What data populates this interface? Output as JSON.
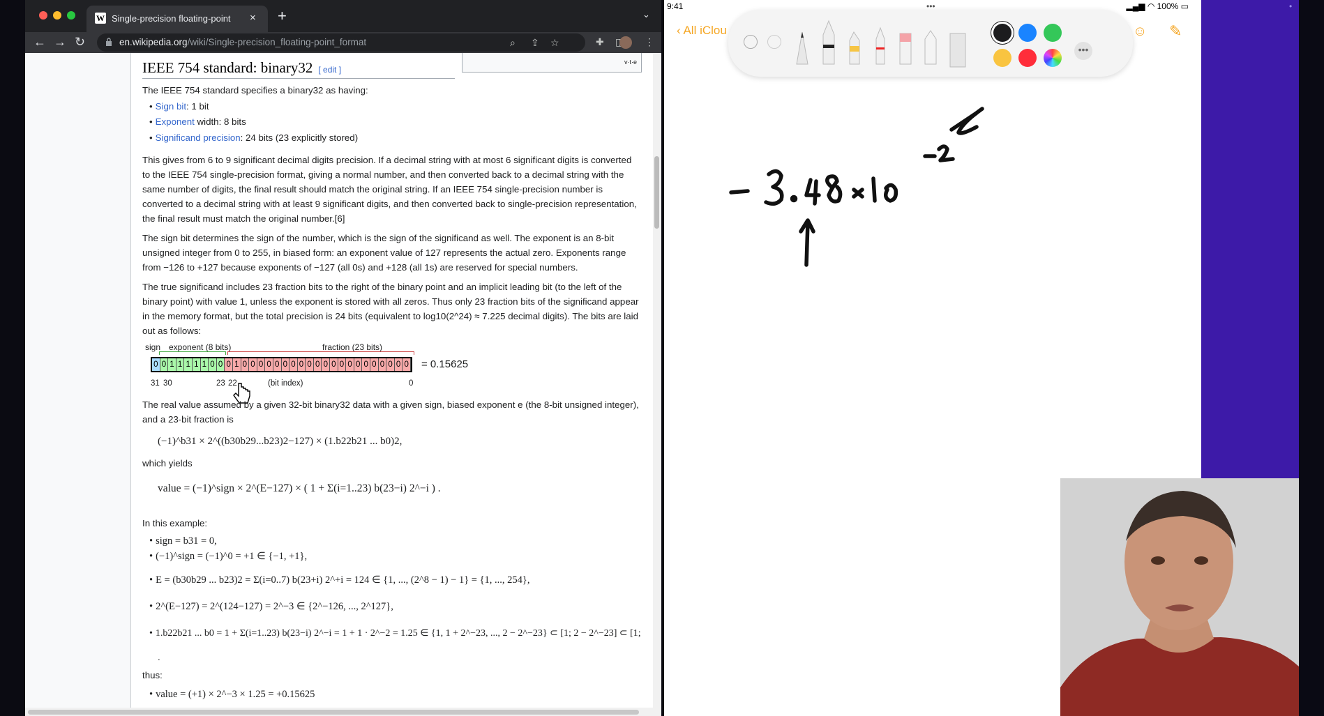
{
  "browser": {
    "tab_title": "Single-precision floating-point",
    "url_domain": "en.wikipedia.org",
    "url_path": "/wiki/Single-precision_floating-point_format",
    "favicon_letter": "W"
  },
  "article": {
    "navbox_label": "v·t·e",
    "heading": "IEEE 754 standard: binary32",
    "edit_label": "[ edit ]",
    "intro": "The IEEE 754 standard specifies a binary32 as having:",
    "bullets": [
      {
        "link": "Sign bit",
        "rest": ": 1 bit"
      },
      {
        "link": "Exponent",
        "rest": " width: 8 bits"
      },
      {
        "link": "Significand precision",
        "rest": ": 24 bits (23 explicitly stored)"
      }
    ],
    "para1_lines": [
      "This gives from 6 to 9 significant decimal digits precision. If a decimal string with at most 6 significant digits is converted",
      "to the IEEE 754 single-precision format, giving a normal number, and then converted back to a decimal string with the",
      "same number of digits, the final result should match the original string. If an IEEE 754 single-precision number is",
      "converted to a decimal string with at least 9 significant digits, and then converted back to single-precision representation,",
      "the final result must match the original number.[6]"
    ],
    "para2_lines": [
      "The sign bit determines the sign of the number, which is the sign of the significand as well. The exponent is an 8-bit",
      "unsigned integer from 0 to 255, in biased form: an exponent value of 127 represents the actual zero. Exponents range",
      "from −126 to +127 because exponents of −127 (all 0s) and +128 (all 1s) are reserved for special numbers."
    ],
    "para3_lines": [
      "The true significand includes 23 fraction bits to the right of the binary point and an implicit leading bit (to the left of the",
      "binary point) with value 1, unless the exponent is stored with all zeros. Thus only 23 fraction bits of the significand appear",
      "in the memory format, but the total precision is 24 bits (equivalent to log10(2^24) ≈ 7.225 decimal digits). The bits are laid",
      "out as follows:"
    ],
    "diagram": {
      "sign_label": "sign",
      "exponent_label": "exponent (8 bits)",
      "fraction_label": "fraction (23 bits)",
      "bits": "00111110001000000000000000000000",
      "result": "= 0.15625",
      "index_labels": [
        "31",
        "30",
        "23",
        "22",
        "(bit index)",
        "0"
      ]
    },
    "para4_lines": [
      "The real value assumed by a given 32-bit binary32 data with a given sign, biased exponent e (the 8-bit unsigned integer),",
      "and a 23-bit fraction is"
    ],
    "formula1": "(−1)^b31 × 2^((b30b29...b23)2−127) × (1.b22b21 ... b0)2,",
    "which_yields": "which yields",
    "formula2": "value = (−1)^sign × 2^(E−127) × ( 1 + Σ(i=1..23) b(23−i) 2^−i ) .",
    "example_label": "In this example:",
    "example_items": [
      "sign = b31 = 0,",
      "(−1)^sign = (−1)^0 = +1 ∈ {−1, +1},",
      "E = (b30b29 ... b23)2 = Σ(i=0..7) b(23+i) 2^+i = 124 ∈ {1, ..., (2^8 − 1) − 1} = {1, ..., 254},",
      "2^(E−127) = 2^(124−127) = 2^−3 ∈ {2^−126, ..., 2^127},",
      "1.b22b21 ... b0 = 1 + Σ(i=1..23) b(23−i) 2^−i = 1 + 1 · 2^−2 = 1.25 ∈ {1, 1 + 2^−23, ..., 2 − 2^−23} ⊂ [1; 2 − 2^−23] ⊂ [1;"
    ],
    "trailing_dot": ".",
    "thus_label": "thus:",
    "final_item": "value = (+1) × 2^−3 × 1.25 = +0.15625"
  },
  "ipad": {
    "time": "9:41",
    "battery": "100%",
    "back_label": "All iClou",
    "handwriting": "−3.48 × 10^−2",
    "colors": [
      "#1c1c1e",
      "#1a84ff",
      "#34c759",
      "#f9c440",
      "#ff2d3a"
    ]
  },
  "accent_colors": {
    "exponent_cell": "#aaf8aa",
    "fraction_cell": "#f8aaaa",
    "sign_cell": "#aaddff",
    "link": "#3366cc"
  }
}
